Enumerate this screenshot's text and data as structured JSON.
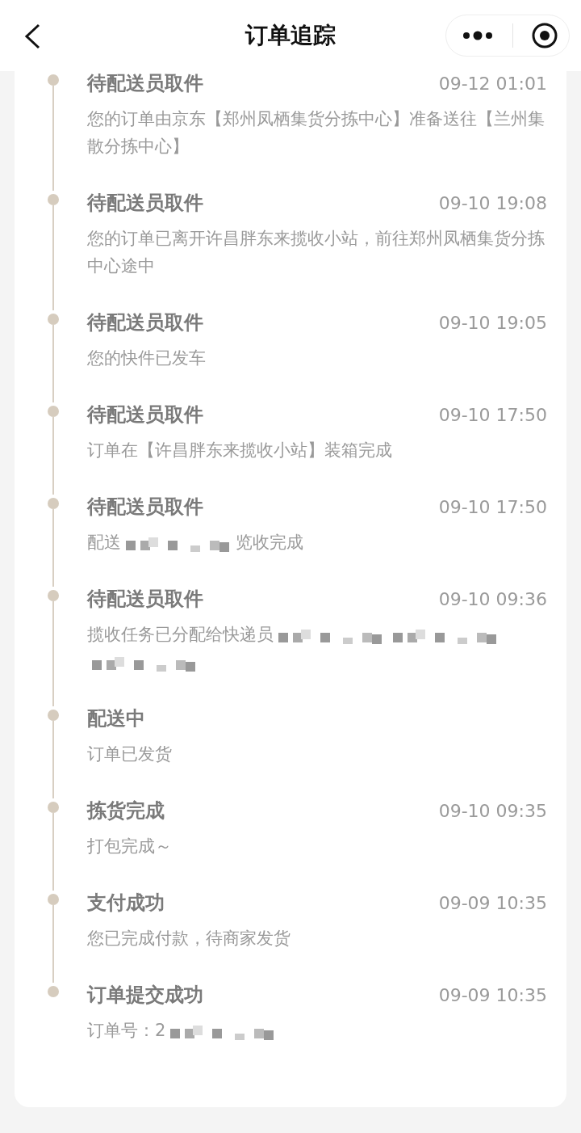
{
  "header": {
    "title": "订单追踪"
  },
  "events": [
    {
      "status": "待配送员取件",
      "time": "09-12 01:01",
      "description": [
        {
          "kind": "text",
          "text": "您的订单由京东【郑州凤栖集货分拣中心】准备送往【兰州集散分拣中心】"
        }
      ]
    },
    {
      "status": "待配送员取件",
      "time": "09-10 19:08",
      "description": [
        {
          "kind": "text",
          "text": "您的订单已离开许昌胖东来揽收小站，前往郑州凤栖集货分拣中心途中"
        }
      ]
    },
    {
      "status": "待配送员取件",
      "time": "09-10 19:05",
      "description": [
        {
          "kind": "text",
          "text": "您的快件已发车"
        }
      ]
    },
    {
      "status": "待配送员取件",
      "time": "09-10 17:50",
      "description": [
        {
          "kind": "text",
          "text": "订单在【许昌胖东来揽收小站】装箱完成"
        }
      ]
    },
    {
      "status": "待配送员取件",
      "time": "09-10 17:50",
      "description": [
        {
          "kind": "text",
          "text": "配送"
        },
        {
          "kind": "redacted"
        },
        {
          "kind": "text",
          "text": "览收完成"
        }
      ]
    },
    {
      "status": "待配送员取件",
      "time": "09-10 09:36",
      "description": [
        {
          "kind": "text",
          "text": "揽收任务已分配给快递员"
        },
        {
          "kind": "redacted"
        },
        {
          "kind": "redacted"
        },
        {
          "kind": "redacted"
        }
      ]
    },
    {
      "status": "配送中",
      "description": [
        {
          "kind": "text",
          "text": "订单已发货"
        }
      ]
    },
    {
      "status": "拣货完成",
      "time": "09-10 09:35",
      "description": [
        {
          "kind": "text",
          "text": "打包完成～"
        }
      ]
    },
    {
      "status": "支付成功",
      "time": "09-09 10:35",
      "description": [
        {
          "kind": "text",
          "text": "您已完成付款，待商家发货"
        }
      ]
    },
    {
      "status": "订单提交成功",
      "time": "09-09 10:35",
      "description": [
        {
          "kind": "text",
          "text": "订单号：2"
        },
        {
          "kind": "redacted"
        }
      ]
    }
  ]
}
